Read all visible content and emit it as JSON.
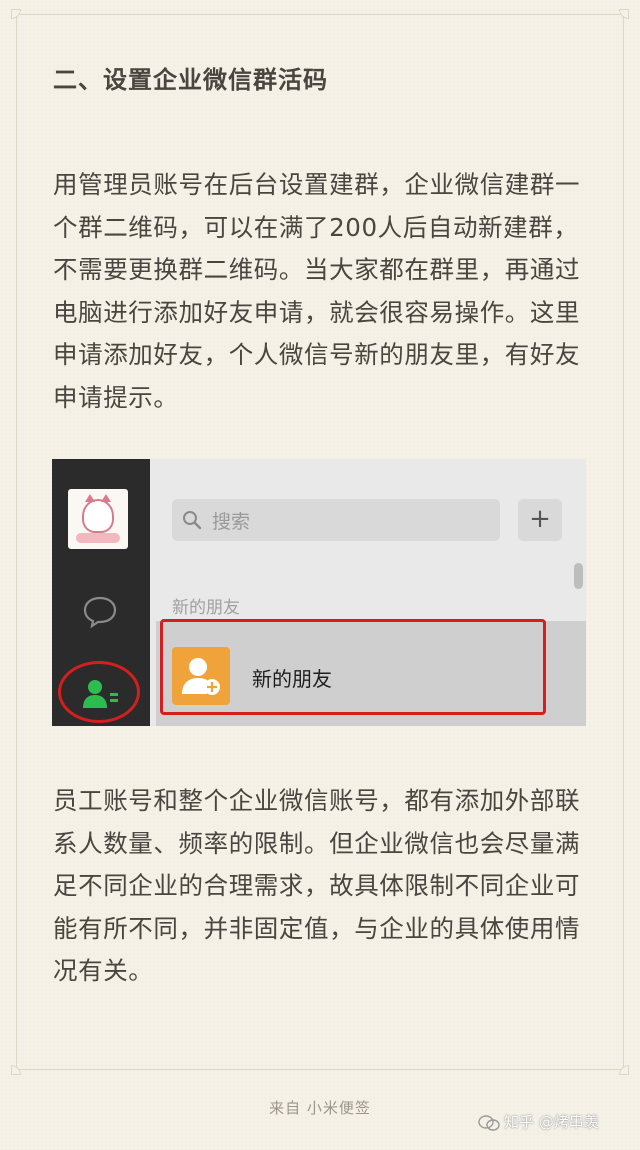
{
  "article": {
    "heading": "二、设置企业微信群活码",
    "paragraph1": "用管理员账号在后台设置建群，企业微信建群一个群二维码，可以在满了200人后自动新建群，不需要更换群二维码。当大家都在群里，再通过电脑进行添加好友申请，就会很容易操作。这里申请添加好友，个人微信号新的朋友里，有好友申请提示。",
    "paragraph2": "员工账号和整个企业微信账号，都有添加外部联系人数量、频率的限制。但企业微信也会尽量满足不同企业的合理需求，故具体限制不同企业可能有所不同，并非固定值，与企业的具体使用情况有关。"
  },
  "screenshot": {
    "search_placeholder": "搜索",
    "add_button": "+",
    "section_label": "新的朋友",
    "friend_item_label": "新的朋友",
    "icons": [
      "chat-bubble-icon",
      "contacts-icon",
      "search-icon",
      "add-friend-icon"
    ],
    "highlight_color": "#d41f1f",
    "contacts_active_color": "#2dbd4e",
    "friend_icon_color": "#f0a33b"
  },
  "footer": {
    "source": "来自 小米便签"
  },
  "watermark": {
    "text": "知乎 @烤串羡"
  }
}
